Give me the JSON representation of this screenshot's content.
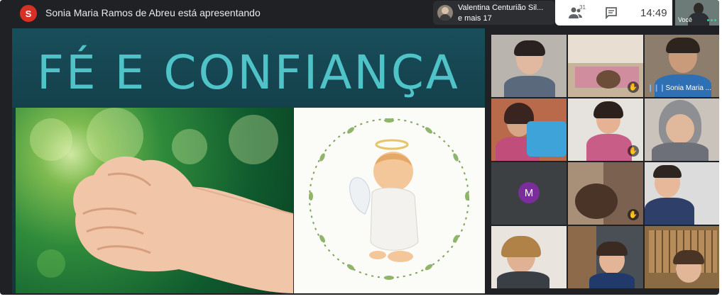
{
  "header": {
    "presenter_initial": "S",
    "presenting_text": "Sonia Maria Ramos de Abreu está apresentando",
    "participant_chip": {
      "line1": "Valentina Centurião Sil...",
      "line2": "e mais 17"
    },
    "people_count": "31",
    "time": "14:49",
    "self_label": "Você",
    "icons": [
      "person-icon",
      "people-icon",
      "chat-icon",
      "more-icon"
    ]
  },
  "presentation": {
    "title": "FÉ E CONFIANÇA"
  },
  "grid": {
    "speaking_name": "Sonia Maria ...",
    "tile_avatar_initial": "M",
    "colors": {
      "avatar_purple": "#7b2d9b",
      "presenter_red": "#d93025",
      "title_teal": "#4fc3c8"
    }
  }
}
